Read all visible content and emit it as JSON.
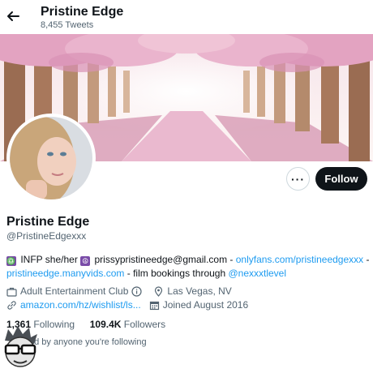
{
  "header": {
    "title": "Pristine Edge",
    "tweet_count": "8,455 Tweets"
  },
  "profile": {
    "name": "Pristine Edge",
    "handle": "@PristineEdgexxx",
    "follow_label": "Follow",
    "more_label": "···"
  },
  "bio": {
    "emoji1": "♎",
    "text1": " INFP she/her ",
    "emoji2": "☮",
    "text2": " prissypristineedge@gmail.com - ",
    "link1": "onlyfans.com/pristineedgexxx",
    "text3": " - ",
    "link2": "pristineedge.manyvids.com",
    "text4": " - film bookings through ",
    "link3": "@nexxxtlevel"
  },
  "meta": {
    "category": "Adult Entertainment Club",
    "location": "Las Vegas, NV",
    "website": "amazon.com/hz/wishlist/ls...",
    "joined": "Joined August 2016"
  },
  "stats": {
    "following_count": "1,361",
    "following_label": " Following",
    "followers_count": "109.4K",
    "followers_label": " Followers",
    "followed_by": "ed by anyone you're following"
  },
  "colors": {
    "accent": "#1d9bf0",
    "follow_bg": "#0f1419",
    "blossom": "#e8a9c8"
  }
}
